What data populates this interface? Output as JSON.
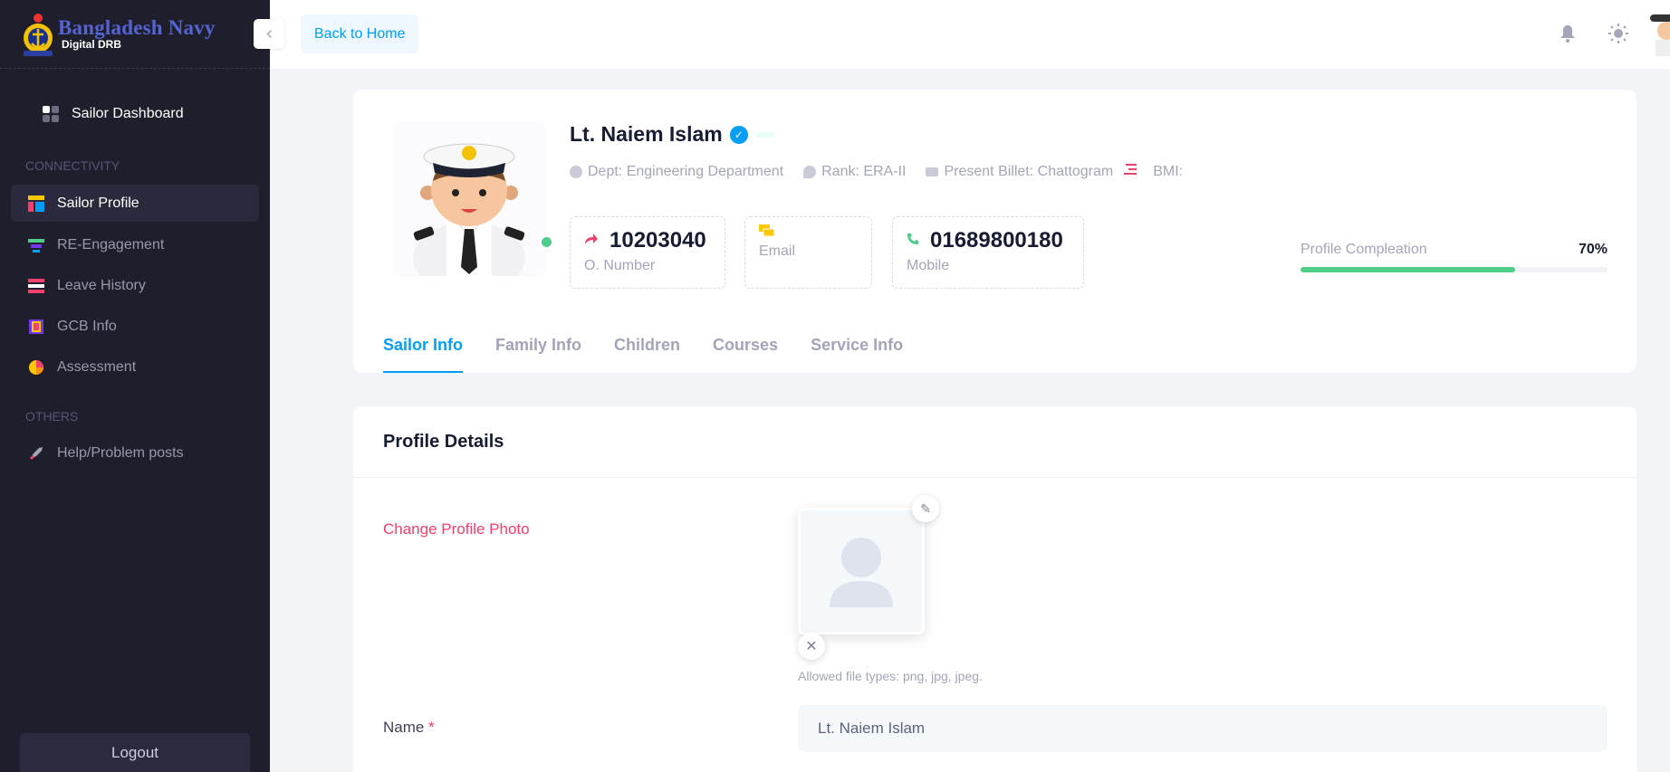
{
  "brand": {
    "title": "Bangladesh Navy",
    "subtitle": "Digital DRB"
  },
  "sidebar": {
    "dashboard_label": "Sailor Dashboard",
    "section_connectivity": "CONNECTIVITY",
    "section_others": "OTHERS",
    "items": [
      {
        "label": "Sailor Profile",
        "icon": "profile-layout-icon"
      },
      {
        "label": "RE-Engagement",
        "icon": "layers-icon"
      },
      {
        "label": "Leave History",
        "icon": "list-icon"
      },
      {
        "label": "GCB Info",
        "icon": "book-icon"
      },
      {
        "label": "Assessment",
        "icon": "pie-chart-icon"
      }
    ],
    "help_label": "Help/Problem posts",
    "logout_label": "Logout"
  },
  "header": {
    "back_label": "Back to Home"
  },
  "profile": {
    "name": "Lt. Naiem Islam",
    "dept": "Dept: Engineering Department",
    "rank": "Rank: ERA-II",
    "billet": "Present Billet: Chattogram",
    "bmi": "BMI:",
    "o_number": "10203040",
    "o_number_label": "O. Number",
    "email_label": "Email",
    "mobile": "01689800180",
    "mobile_label": "Mobile",
    "completion_label": "Profile Compleation",
    "completion_value": "70%",
    "completion_fraction": 0.7
  },
  "tabs": [
    "Sailor Info",
    "Family Info",
    "Children",
    "Courses",
    "Service Info"
  ],
  "details": {
    "title": "Profile Details",
    "change_photo_label": "Change Profile Photo",
    "file_hint": "Allowed file types: png, jpg, jpeg.",
    "name_label": "Name",
    "name_required": "*",
    "name_value": "Lt. Naiem Islam"
  },
  "colors": {
    "accent": "#009ef7",
    "success": "#50cd89",
    "danger": "#f1416c",
    "sidebar_bg": "#1e1e2d"
  }
}
